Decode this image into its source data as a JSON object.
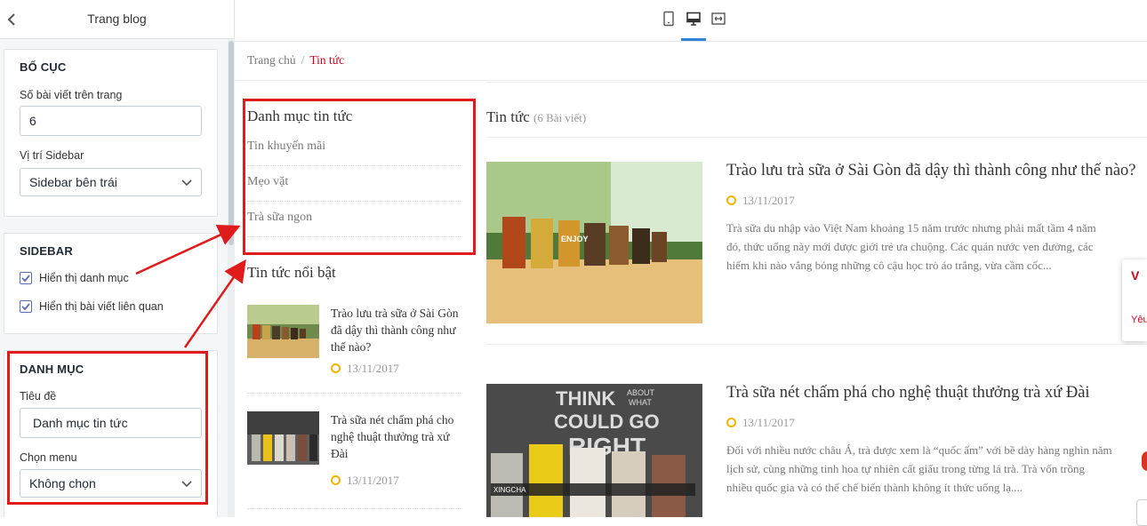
{
  "editor": {
    "title": "Trang blog",
    "layout": {
      "heading": "BỐ CỤC",
      "posts_label": "Số bài viết trên trang",
      "posts_value": "6",
      "sidebar_pos_label": "Vị trí Sidebar",
      "sidebar_pos_value": "Sidebar bên trái"
    },
    "sidebar": {
      "heading": "SIDEBAR",
      "opt1": "Hiển thị danh mục",
      "opt2": "Hiển thị bài viết liên quan"
    },
    "category": {
      "heading": "DANH MỤC",
      "title_label": "Tiêu đề",
      "title_value": "Danh mục tin tức",
      "menu_label": "Chọn menu",
      "menu_value": "Không chọn"
    }
  },
  "device_icons": [
    "tablet-icon",
    "desktop-icon",
    "fullwidth-icon"
  ],
  "preview": {
    "breadcrumb": {
      "home": "Trang chủ",
      "sep": "/",
      "current": "Tin tức"
    },
    "sidebar": {
      "categories_title": "Danh mục tin tức",
      "categories": [
        "Tin khuyến mãi",
        "Mẹo vặt",
        "Trà sữa ngon"
      ],
      "featured_title": "Tin tức nổi bật",
      "featured": [
        {
          "title": "Trào lưu trà sữa ở Sài Gòn đã dậy thì thành công như thế nào?",
          "date": "13/11/2017"
        },
        {
          "title": "Trà sữa nét chấm phá cho nghệ thuật thưởng trà xứ Đài",
          "date": "13/11/2017"
        }
      ]
    },
    "main": {
      "title": "Tin tức",
      "count": "(6 Bài viết)",
      "posts": [
        {
          "title": "Trào lưu trà sữa ở Sài Gòn đã dậy thì thành công như thế nào?",
          "date": "13/11/2017",
          "excerpt": [
            "Trà sữa du nhập vào Việt Nam khoảng 15 năm trước nhưng phải mất tầm 4 năm",
            "đó, thức uống này mới được giới trẻ ưa chuộng. Các quán nước ven đường, các",
            "hiếm khi nào vắng bóng những cô cậu học trò áo trắng, vừa cầm cốc..."
          ]
        },
        {
          "title": "Trà sữa nét chấm phá cho nghệ thuật thưởng trà xứ Đài",
          "date": "13/11/2017",
          "excerpt": [
            "Đối với nhiều nước châu Á, trà được xem là “quốc ẩm” với bề dày hàng nghìn năm",
            "lịch sử, cùng những tinh hoa tự nhiên cất giấu trong từng lá trà. Trà vốn trồng",
            "nhiều quốc gia và có thể chế biến thành không ít thức uống lạ...."
          ]
        }
      ]
    },
    "popup": {
      "v": "V",
      "y": "Yêu"
    },
    "image_text": {
      "enjoy": "ENJOY",
      "think": "THINK",
      "about": "ABOUT",
      "what": "WHAT",
      "could": "COULD GO",
      "right": "RIGHT",
      "brand": "XINGCHA"
    }
  },
  "colors": {
    "accent": "#d0021b",
    "annotation": "#e01b1b",
    "check": "#5c6ac4",
    "tab": "#2f85d8",
    "clock": "#f5b400"
  }
}
